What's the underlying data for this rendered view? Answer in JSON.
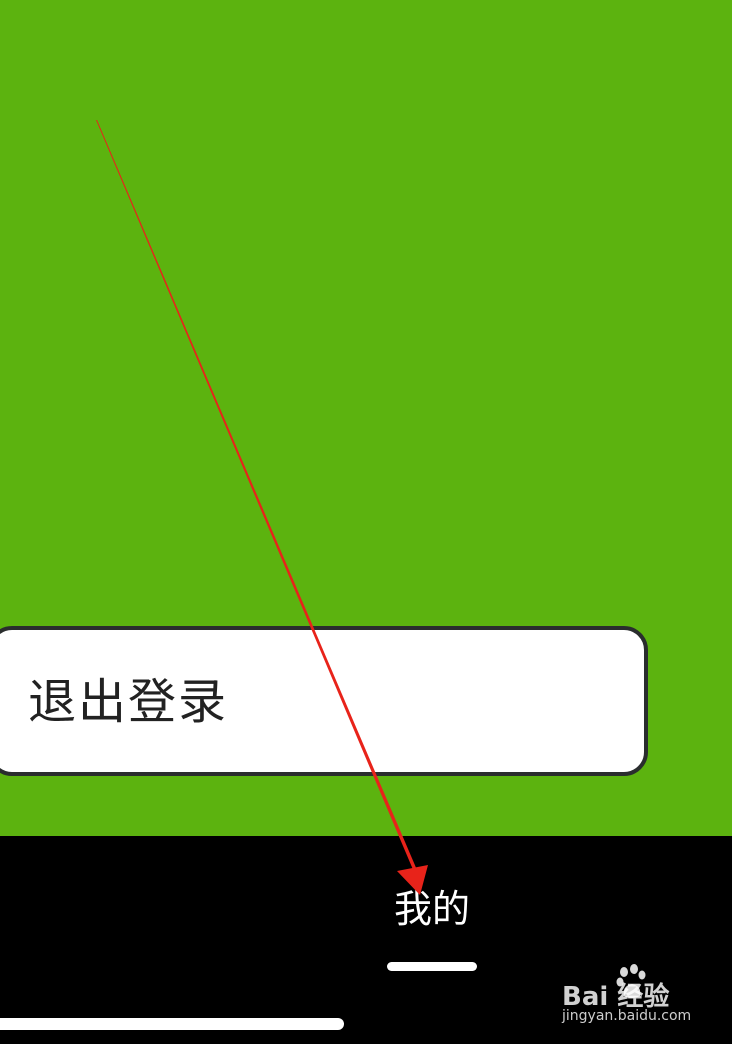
{
  "main": {
    "logout_label": "退出登录"
  },
  "tab_bar": {
    "active_tab_label": "我的"
  },
  "watermark": {
    "logo_text": "Bai  经验",
    "sub_text": "jingyan.baidu.com"
  },
  "colors": {
    "background_green": "#5cb30f",
    "tab_bar_black": "#000000",
    "annotation_arrow": "#e8231a"
  }
}
